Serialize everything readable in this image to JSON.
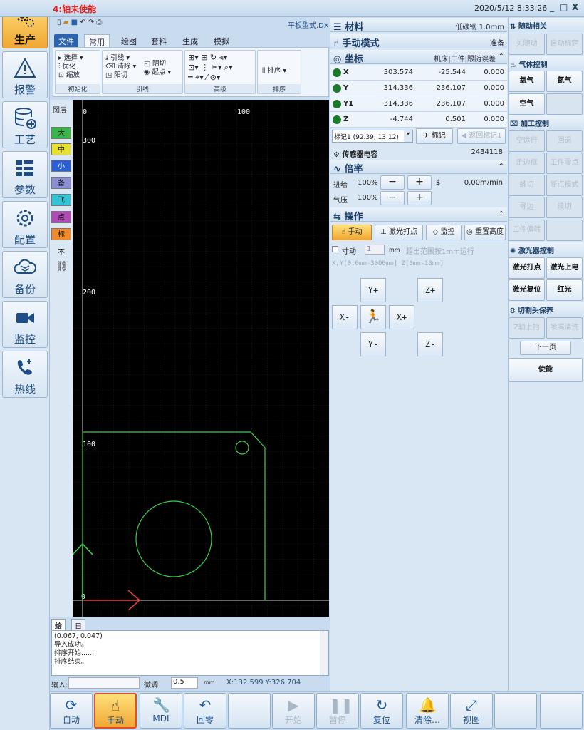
{
  "title": "4:轴未使能",
  "datetime": "2020/5/12 8:33:26",
  "window_buttons": [
    "_",
    "□",
    "X"
  ],
  "filename": "平板型式.DX",
  "nav": [
    {
      "label": "生产",
      "icon": "gears-icon"
    },
    {
      "label": "报警",
      "icon": "warning-icon"
    },
    {
      "label": "工艺",
      "icon": "database-icon"
    },
    {
      "label": "参数",
      "icon": "list-icon"
    },
    {
      "label": "配置",
      "icon": "gear-icon"
    },
    {
      "label": "备份",
      "icon": "cloud-icon"
    },
    {
      "label": "监控",
      "icon": "camera-icon"
    },
    {
      "label": "热线",
      "icon": "phone-icon"
    }
  ],
  "ribbon": {
    "tabs": [
      "文件",
      "常用",
      "绘图",
      "套料",
      "生成",
      "模拟"
    ],
    "groups": [
      {
        "label": "初始化",
        "items": [
          "选择",
          "优化",
          "缩放"
        ]
      },
      {
        "label": "引线",
        "items": [
          "引线",
          "清除",
          "阳切",
          "阴切",
          "起点"
        ]
      },
      {
        "label": "高级",
        "items": []
      },
      {
        "label": "排序",
        "items": [
          "排序"
        ]
      }
    ]
  },
  "layers": {
    "title": "图层",
    "items": [
      {
        "label": "大",
        "color": "#39b54a"
      },
      {
        "label": "中",
        "color": "#e8e02a"
      },
      {
        "label": "小",
        "color": "#2a5fd8"
      },
      {
        "label": "备",
        "color": "#8a8fd6"
      },
      {
        "label": "飞",
        "color": "#34c6d6"
      },
      {
        "label": "点",
        "color": "#b04ab5"
      },
      {
        "label": "标",
        "color": "#f08a2a"
      },
      {
        "label": "不",
        "color": "#dbe7f3"
      }
    ]
  },
  "canvas": {
    "labels": [
      "0",
      "100",
      "300",
      "200",
      "100",
      "0"
    ]
  },
  "log": {
    "tabs": [
      "绘图",
      "日志"
    ],
    "lines": [
      "(0.067, 0.047)",
      "导入成功。",
      "排序开始......",
      "排序结束。"
    ],
    "input_label": "输入:",
    "jog_label": "微调",
    "jog_value": "0.5",
    "unit": "mm",
    "cursor_pos": "X:132.599 Y:326.704"
  },
  "material": {
    "title": "材料",
    "value": "低碳钢 1.0mm"
  },
  "manual": {
    "title": "手动模式",
    "status": "准备"
  },
  "coords": {
    "title": "坐标",
    "header": "机床|工件|跟随误差",
    "rows": [
      {
        "axis": "X",
        "machine": "303.574",
        "work": "-25.544",
        "error": "0.000"
      },
      {
        "axis": "Y",
        "machine": "314.336",
        "work": "236.107",
        "error": "0.000"
      },
      {
        "axis": "Y1",
        "machine": "314.336",
        "work": "236.107",
        "error": "0.000"
      },
      {
        "axis": "Z",
        "machine": "-4.744",
        "work": "0.501",
        "error": "0.000"
      }
    ]
  },
  "marker": {
    "select": "标记1 (92.39, 13.12)",
    "mark_label": "标记",
    "return_label": "返回标记1"
  },
  "sensor": {
    "label": "传感器电容",
    "value": "2434118"
  },
  "rate": {
    "title": "倍率",
    "feed_label": "进给",
    "feed_value": "100%",
    "s_label": "$",
    "speed_value": "0.00m/min",
    "gas_label": "气压",
    "gas_value": "100%"
  },
  "operation": {
    "title": "操作",
    "buttons": [
      "手动",
      "激光打点",
      "监控",
      "重置高度"
    ],
    "step_label": "寸动",
    "step_value": "1",
    "step_unit": "mm",
    "overrange": "超出范围按1mm运行",
    "range": "X,Y[0.0mm-3000mm]  Z[0mm-10mm]",
    "jog": {
      "y_plus": "Y+",
      "z_plus": "Z+",
      "x_minus": "X-",
      "x_plus": "X+",
      "y_minus": "Y-",
      "z_minus": "Z-"
    }
  },
  "right": {
    "follow": {
      "title": "随动相关",
      "buttons": [
        "关随动",
        "自动标定"
      ]
    },
    "gas": {
      "title": "气体控制",
      "buttons": [
        "氧气",
        "氮气",
        "空气",
        ""
      ]
    },
    "process": {
      "title": "加工控制",
      "buttons": [
        "空运行",
        "回退",
        "走边框",
        "工件零点",
        "蛙切",
        "断点模式",
        "寻边",
        "续切",
        "工件偏转",
        ""
      ]
    },
    "laser": {
      "title": "激光器控制",
      "buttons": [
        "激光打点",
        "激光上电",
        "激光复位",
        "红光"
      ]
    },
    "head": {
      "title": "切割头保养",
      "buttons": [
        "Z轴上抬",
        "喷嘴清洗"
      ]
    },
    "next_page": "下一页",
    "enable": "使能"
  },
  "bottom": [
    {
      "label": "自动",
      "icon": "refresh-icon",
      "active": false,
      "disabled": false
    },
    {
      "label": "手动",
      "icon": "hand-icon",
      "active": true,
      "disabled": false
    },
    {
      "label": "MDI",
      "icon": "wrench-icon",
      "active": false,
      "disabled": false
    },
    {
      "label": "回零",
      "icon": "undo-icon",
      "active": false,
      "disabled": false
    },
    {
      "label": "",
      "icon": "",
      "active": false,
      "disabled": false
    },
    {
      "label": "开始",
      "icon": "play-icon",
      "active": false,
      "disabled": true
    },
    {
      "label": "暂停",
      "icon": "pause-icon",
      "active": false,
      "disabled": true
    },
    {
      "label": "复位",
      "icon": "reset-icon",
      "active": false,
      "disabled": false
    },
    {
      "label": "清除…",
      "icon": "bell-icon",
      "active": false,
      "disabled": false
    },
    {
      "label": "视图",
      "icon": "expand-icon",
      "active": false,
      "disabled": false
    },
    {
      "label": "",
      "icon": "",
      "active": false,
      "disabled": false
    },
    {
      "label": "",
      "icon": "",
      "active": false,
      "disabled": false
    }
  ]
}
